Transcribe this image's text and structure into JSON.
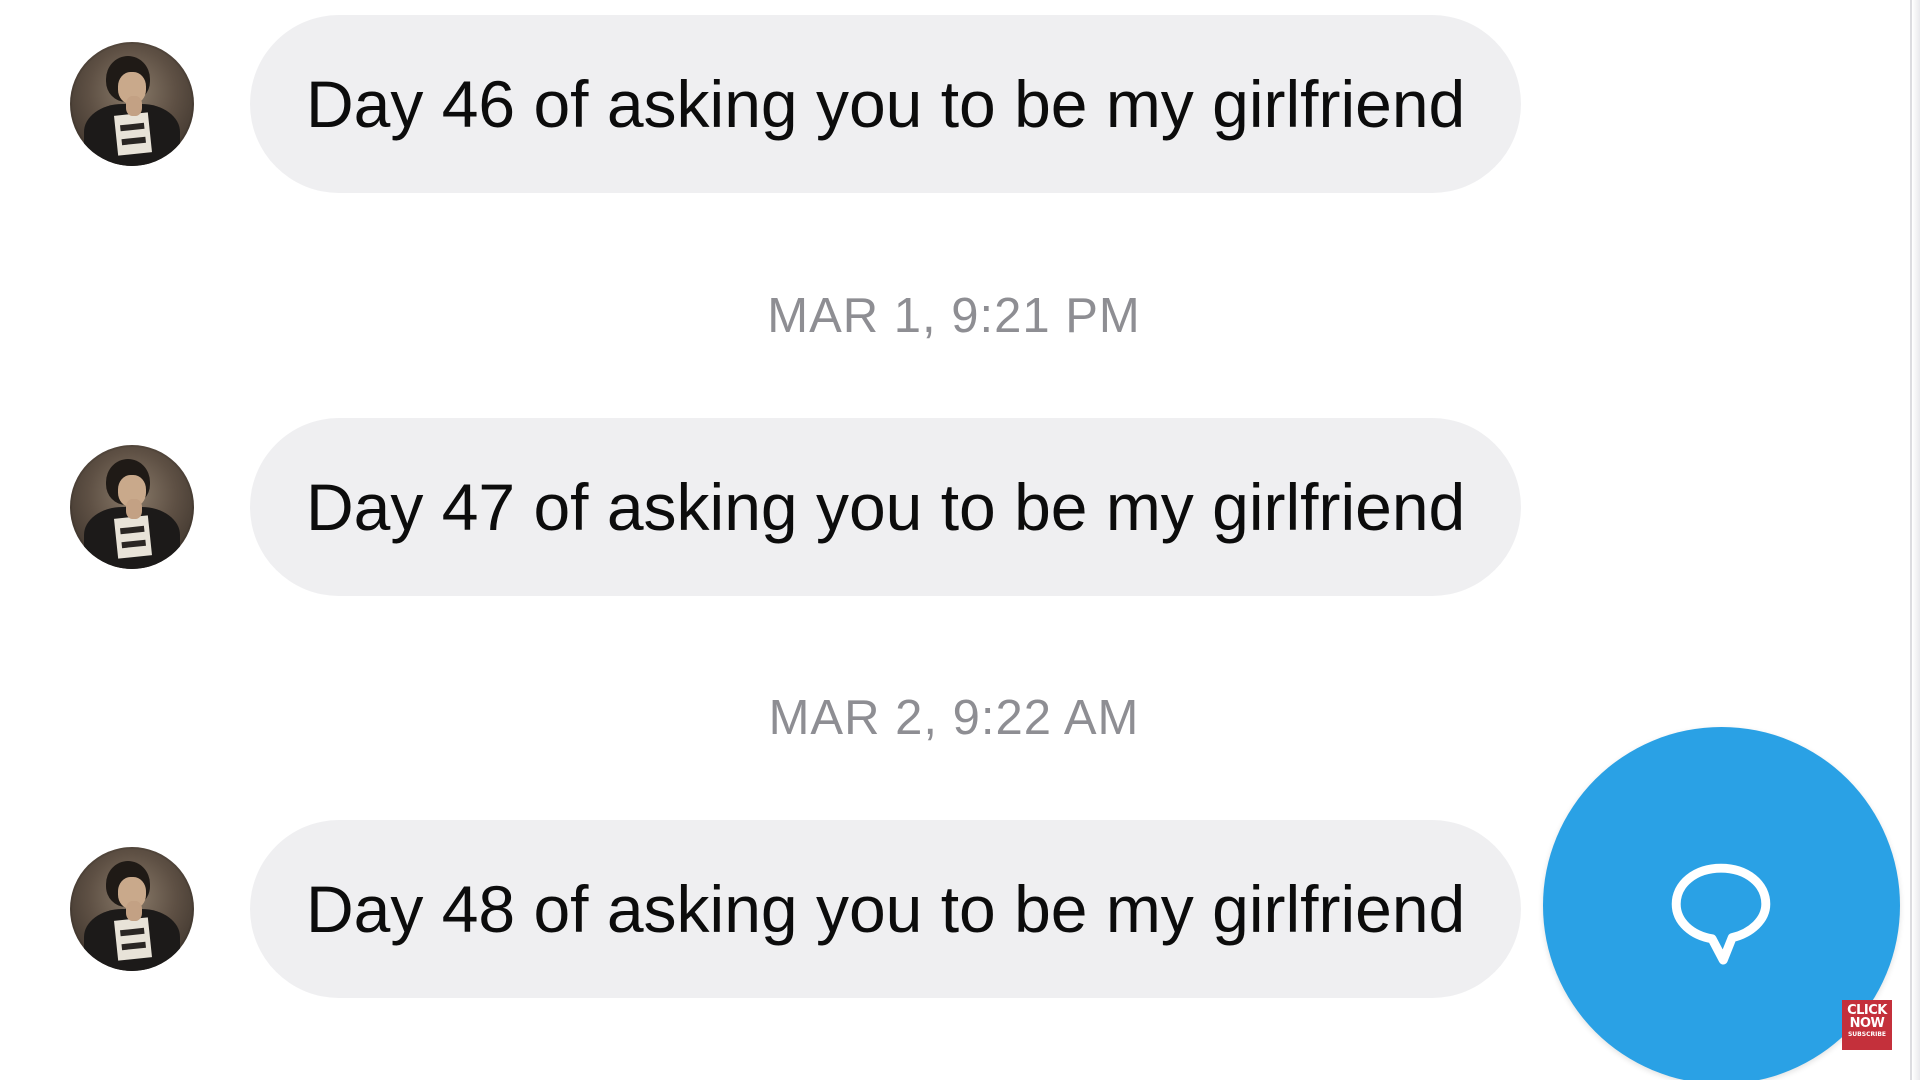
{
  "thread": {
    "messages": [
      {
        "text": "Day 46 of asking you to be my girlfriend"
      },
      {
        "text": "Day 47 of asking you to be my girlfriend"
      },
      {
        "text": "Day 48 of asking you to be my girlfriend"
      }
    ],
    "timestamps": [
      "MAR 1, 9:21 PM",
      "MAR 2, 9:22 AM"
    ]
  },
  "fab": {
    "icon": "speech-bubble-icon",
    "color": "#2aa1e5"
  },
  "subscribe_badge": {
    "line1": "CLICK",
    "line2": "NOW",
    "line3": "SUBSCRIBE",
    "color": "#c4303b"
  },
  "colors": {
    "bubble_background": "#efeff1",
    "message_text": "#0c0c0c",
    "timestamp_text": "#8e8e93"
  }
}
